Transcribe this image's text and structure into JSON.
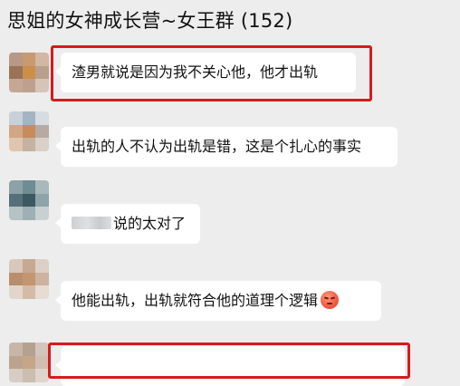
{
  "header": {
    "title": "思姐的女神成长营~女王群 (152)"
  },
  "messages": [
    {
      "text": "渣男就说是因为我不关心他，他才出轨",
      "highlighted": true
    },
    {
      "text": "出轨的人不认为出轨是错，这是个扎心的事实",
      "highlighted": false
    },
    {
      "text": "说的太对了",
      "highlighted": false,
      "has_blurred_mention": true
    },
    {
      "text": "他能出轨，出轨就符合他的道理个逻辑",
      "highlighted": false,
      "emoji": "sad-face-emoji"
    },
    {
      "text": "",
      "highlighted": true
    }
  ],
  "colors": {
    "background": "#ededed",
    "bubble": "#ffffff",
    "highlight": "#d9191c"
  }
}
